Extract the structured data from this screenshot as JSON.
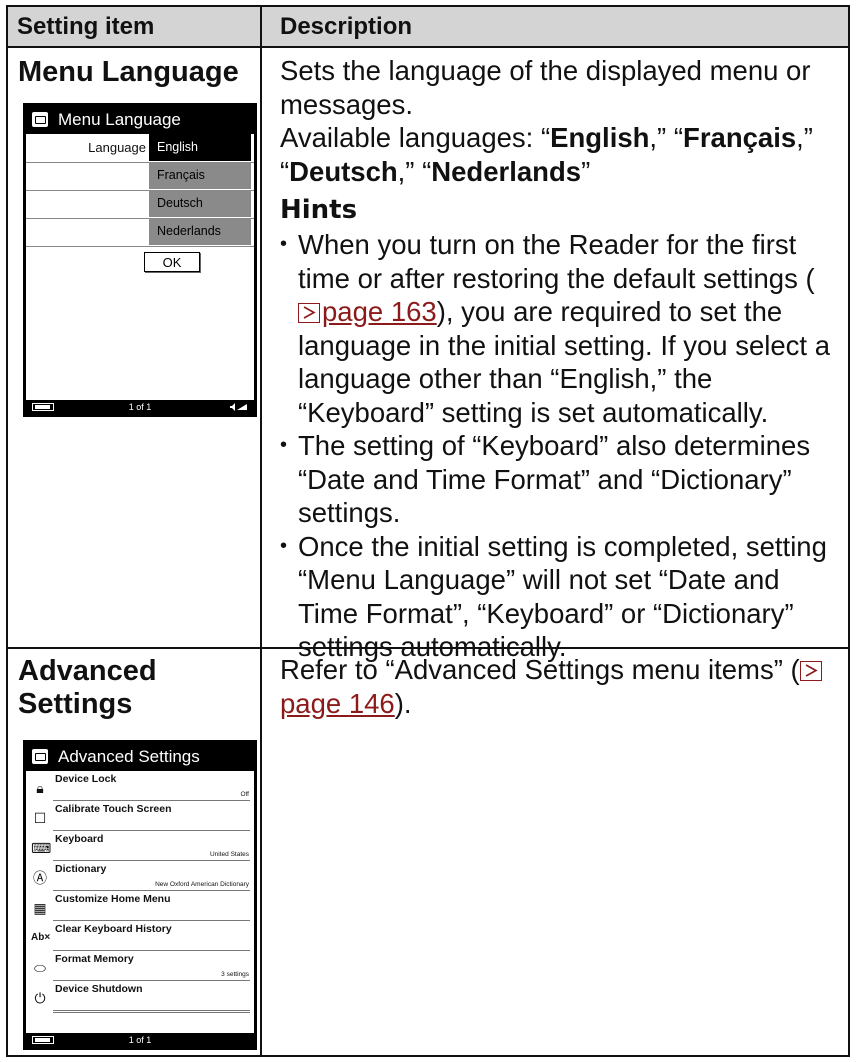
{
  "header": {
    "col1": "Setting item",
    "col2": "Description"
  },
  "menu_language": {
    "title": "Menu Language",
    "screen": {
      "title": "Menu Language",
      "field_label": "Language",
      "options": [
        "English",
        "Français",
        "Deutsch",
        "Nederlands"
      ],
      "selected": "English",
      "ok": "OK",
      "page": "1 of 1"
    },
    "desc_line1": "Sets the language of the displayed menu or messages.",
    "avail_prefix": "Available languages: “",
    "lang1": "English",
    "sep1": ",” “",
    "lang2": "Français",
    "sep2": ",” “",
    "lang3": "Deutsch",
    "sep3": ",” “",
    "lang4": "Nederlands",
    "avail_suffix": "”",
    "hints_title": "Hints",
    "hint1_pre": "When you turn on the Reader for the first time or after restoring the default settings (",
    "hint1_link": "page 163",
    "hint1_post": "), you are required to set the language in the initial setting. If you select a language other than “English,” the “Keyboard” setting is set automatically.",
    "hint2": "The setting of “Keyboard” also determines “Date and Time Format” and “Dictionary” settings.",
    "hint3": "Once the initial setting is completed, setting “Menu Language” will not set “Date and Time Format”, “Keyboard” or “Dictionary” settings automatically."
  },
  "advanced_settings": {
    "title_line1": "Advanced",
    "title_line2": "Settings",
    "desc_pre": "Refer to “Advanced Settings menu items” (",
    "desc_link": "page 146",
    "desc_post": ").",
    "screen": {
      "title": "Advanced Settings",
      "items": [
        {
          "icon": "lock-icon",
          "label": "Device Lock",
          "value": "Off"
        },
        {
          "icon": "touch-screen-icon",
          "label": "Calibrate Touch Screen",
          "value": ""
        },
        {
          "icon": "keyboard-icon",
          "label": "Keyboard",
          "value": "United States"
        },
        {
          "icon": "dictionary-icon",
          "label": "Dictionary",
          "value": "New Oxford American Dictionary"
        },
        {
          "icon": "home-menu-icon",
          "label": "Customize Home Menu",
          "value": ""
        },
        {
          "icon": "clear-history-icon",
          "label": "Clear Keyboard History",
          "value": ""
        },
        {
          "icon": "memory-icon",
          "label": "Format Memory",
          "value": "3 settings"
        },
        {
          "icon": "power-icon",
          "label": "Device Shutdown",
          "value": ""
        }
      ],
      "page": "1 of 1"
    }
  }
}
